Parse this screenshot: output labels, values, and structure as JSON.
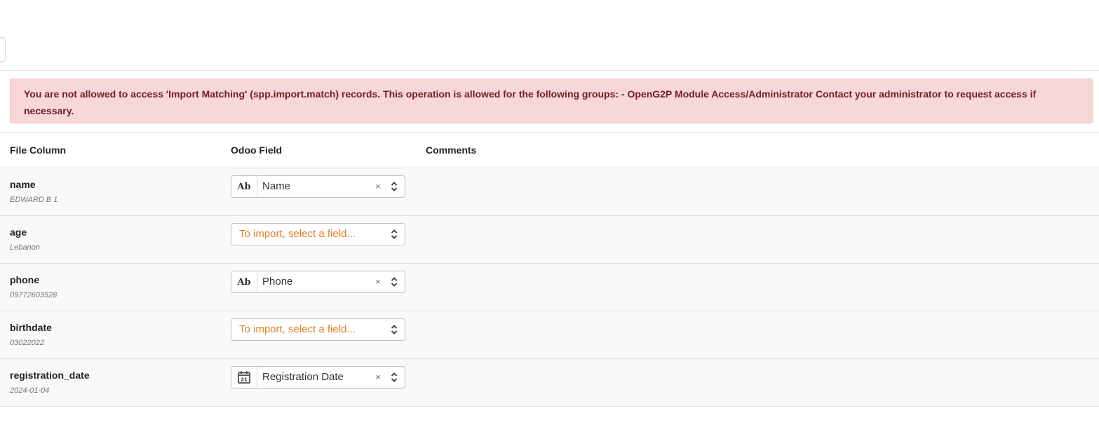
{
  "alert": {
    "message": "You are not allowed to access 'Import Matching' (spp.import.match) records. This operation is allowed for the following groups: - OpenG2P Module Access/Administrator Contact your administrator to request access if necessary."
  },
  "table": {
    "headers": {
      "file_column": "File Column",
      "odoo_field": "Odoo Field",
      "comments": "Comments"
    },
    "rows": [
      {
        "column": "name",
        "sample": "EDWARD B 1",
        "field_icon": "text-type-icon",
        "field_icon_text": "Ab",
        "field": "Name",
        "placeholder": ""
      },
      {
        "column": "age",
        "sample": "Lebanon",
        "field_icon": "",
        "field_icon_text": "",
        "field": "",
        "placeholder": "To import, select a field..."
      },
      {
        "column": "phone",
        "sample": "09772603528",
        "field_icon": "text-type-icon",
        "field_icon_text": "Ab",
        "field": "Phone",
        "placeholder": ""
      },
      {
        "column": "birthdate",
        "sample": "03022022",
        "field_icon": "",
        "field_icon_text": "",
        "field": "",
        "placeholder": "To import, select a field..."
      },
      {
        "column": "registration_date",
        "sample": "2024-01-04",
        "field_icon": "calendar-icon",
        "field_icon_text": "21",
        "field": "Registration Date",
        "placeholder": ""
      }
    ]
  },
  "icons": {
    "clear": "×",
    "chevron": "chevron-up-down-icon"
  },
  "colors": {
    "alert_bg": "#f8d7da",
    "alert_text": "#721c24",
    "placeholder_text": "#e67e22",
    "row_bg": "#f9f9f9"
  }
}
